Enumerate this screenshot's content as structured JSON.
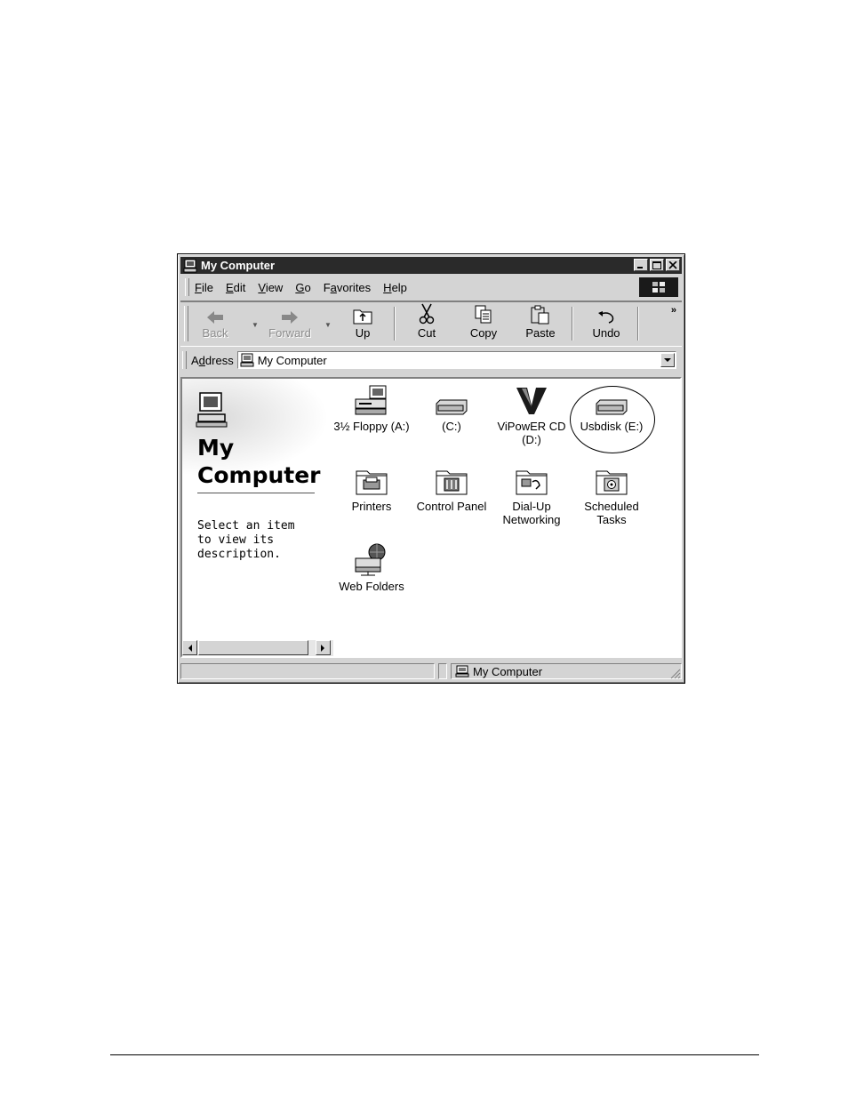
{
  "window": {
    "title": "My Computer"
  },
  "menu": [
    {
      "pre": "",
      "u": "F",
      "post": "ile"
    },
    {
      "pre": "",
      "u": "E",
      "post": "dit"
    },
    {
      "pre": "",
      "u": "V",
      "post": "iew"
    },
    {
      "pre": "",
      "u": "G",
      "post": "o"
    },
    {
      "pre": "F",
      "u": "a",
      "post": "vorites"
    },
    {
      "pre": "",
      "u": "H",
      "post": "elp"
    }
  ],
  "toolbar": {
    "back": "Back",
    "forward": "Forward",
    "up": "Up",
    "cut": "Cut",
    "copy": "Copy",
    "paste": "Paste",
    "undo": "Undo",
    "more": "»"
  },
  "address": {
    "label_pre": "A",
    "label_u": "d",
    "label_post": "dress",
    "value": "My Computer"
  },
  "left_pane": {
    "title_line1": "My",
    "title_line2": "Computer",
    "description": "Select an item to view its description."
  },
  "items": [
    {
      "label": "3½ Floppy (A:)",
      "icon": "floppy-drive-icon"
    },
    {
      "label": "(C:)",
      "icon": "hard-drive-icon"
    },
    {
      "label": "ViPowER CD (D:)",
      "icon": "cd-drive-icon"
    },
    {
      "label": "Usbdisk (E:)",
      "icon": "usb-drive-icon"
    },
    {
      "label": "Printers",
      "icon": "printers-folder-icon"
    },
    {
      "label": "Control Panel",
      "icon": "control-panel-folder-icon"
    },
    {
      "label": "Dial-Up Networking",
      "icon": "dialup-folder-icon"
    },
    {
      "label": "Scheduled Tasks",
      "icon": "scheduled-tasks-folder-icon"
    },
    {
      "label": "Web Folders",
      "icon": "web-folders-icon"
    }
  ],
  "status": {
    "zone": "My Computer"
  },
  "colors": {
    "titlebar": "#2a2a2a",
    "chrome": "#d4d4d4",
    "content_bg": "#ffffff"
  }
}
